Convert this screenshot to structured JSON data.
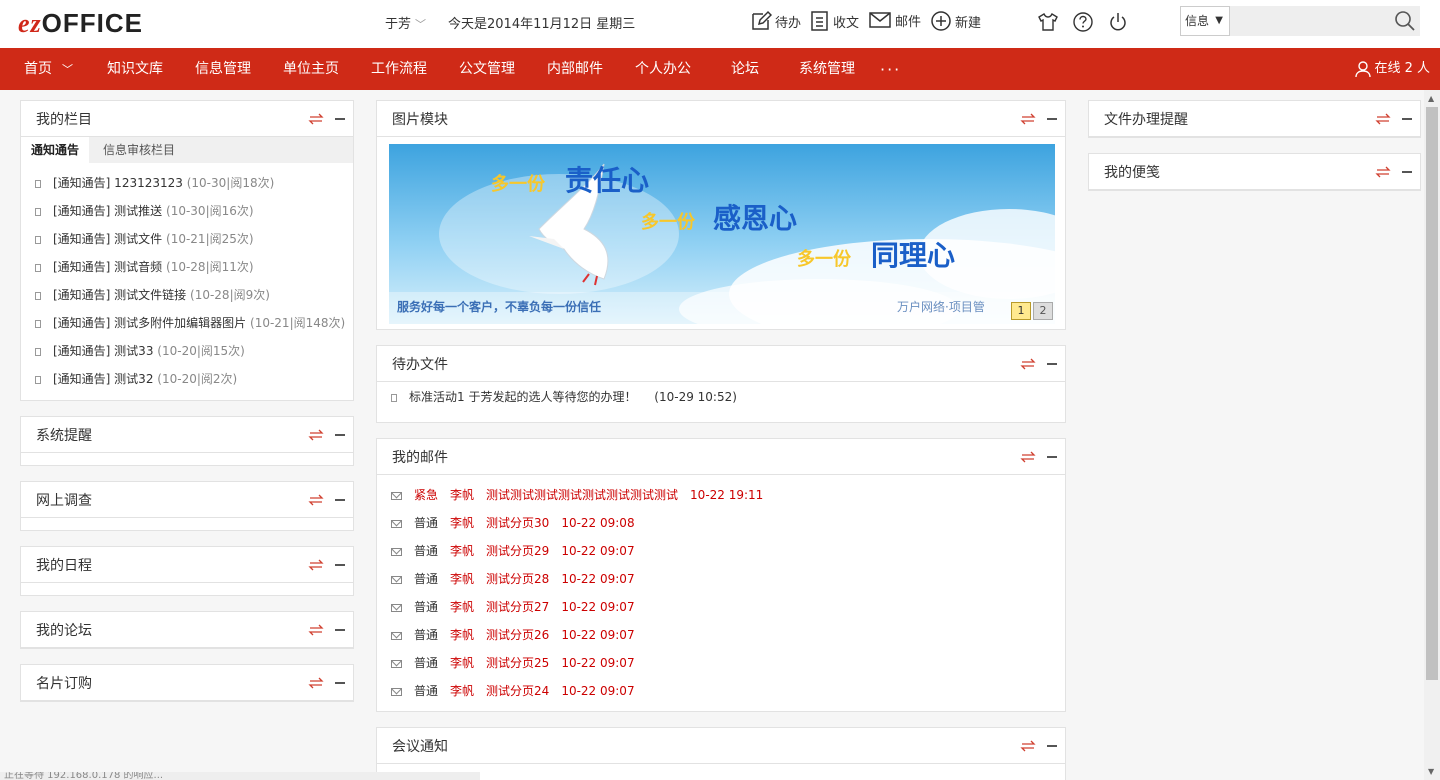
{
  "header": {
    "logo_ez": "ez",
    "logo_office": "OFFICE",
    "user_name": "于芳",
    "today": "今天是2014年11月12日  星期三",
    "quick": {
      "todo": "待办",
      "receive": "收文",
      "mail": "邮件",
      "create": "新建"
    },
    "search": {
      "select_value": "信息",
      "placeholder": ""
    }
  },
  "nav": {
    "items": [
      "首页",
      "知识文库",
      "信息管理",
      "单位主页",
      "工作流程",
      "公文管理",
      "内部邮件",
      "个人办公",
      "论坛",
      "系统管理"
    ],
    "more": "···",
    "online": "在线 2 人"
  },
  "left": {
    "my_columns": {
      "title": "我的栏目",
      "tabs": [
        "通知通告",
        "信息审核栏目"
      ],
      "items": [
        {
          "title": "[通知通告] 123123123",
          "meta": "(10-30|阅18次)"
        },
        {
          "title": "[通知通告] 测试推送",
          "meta": "(10-30|阅16次)"
        },
        {
          "title": "[通知通告] 测试文件",
          "meta": "(10-21|阅25次)"
        },
        {
          "title": "[通知通告] 测试音频",
          "meta": "(10-28|阅11次)"
        },
        {
          "title": "[通知通告] 测试文件链接",
          "meta": "(10-28|阅9次)"
        },
        {
          "title": "[通知通告] 测试多附件加编辑器图片",
          "meta": "(10-21|阅148次)"
        },
        {
          "title": "[通知通告] 测试33",
          "meta": "(10-20|阅15次)"
        },
        {
          "title": "[通知通告] 测试32",
          "meta": "(10-20|阅2次)"
        }
      ]
    },
    "system_reminder": "系统提醒",
    "online_survey": "网上调查",
    "my_schedule": "我的日程",
    "my_forum": "我的论坛",
    "card_order": "名片订购"
  },
  "center": {
    "image_module": {
      "title": "图片模块",
      "banner_line1_a": "多一份",
      "banner_line1_b": "责任心",
      "banner_line2_a": "多一份",
      "banner_line2_b": "感恩心",
      "banner_line3_a": "多一份",
      "banner_line3_b": "同理心",
      "banner_slogan": "服务好每一个客户，不辜负每一份信任",
      "banner_brand": "万户网络·项目管",
      "pages": [
        "1",
        "2"
      ]
    },
    "pending_docs": {
      "title": "待办文件",
      "item_text": "标准活动1   于芳发起的选人等待您的办理！",
      "item_time": "(10-29 10:52)"
    },
    "my_mail": {
      "title": "我的邮件",
      "rows": [
        {
          "level": "紧急",
          "sender": "李帆",
          "subject": "测试测试测试测试测试测试测试测试",
          "time": "10-22 19:11"
        },
        {
          "level": "普通",
          "sender": "李帆",
          "subject": "测试分页30",
          "time": "10-22 09:08"
        },
        {
          "level": "普通",
          "sender": "李帆",
          "subject": "测试分页29",
          "time": "10-22 09:07"
        },
        {
          "level": "普通",
          "sender": "李帆",
          "subject": "测试分页28",
          "time": "10-22 09:07"
        },
        {
          "level": "普通",
          "sender": "李帆",
          "subject": "测试分页27",
          "time": "10-22 09:07"
        },
        {
          "level": "普通",
          "sender": "李帆",
          "subject": "测试分页26",
          "time": "10-22 09:07"
        },
        {
          "level": "普通",
          "sender": "李帆",
          "subject": "测试分页25",
          "time": "10-22 09:07"
        },
        {
          "level": "普通",
          "sender": "李帆",
          "subject": "测试分页24",
          "time": "10-22 09:07"
        }
      ]
    },
    "meeting_notice": "会议通知"
  },
  "right": {
    "file_reminder": "文件办理提醒",
    "my_notes": "我的便笺"
  },
  "statusbar": "正在等待 192.168.0.178 的响应...",
  "colors": {
    "brand_red": "#cf2a17",
    "mail_red": "#cc0000"
  }
}
